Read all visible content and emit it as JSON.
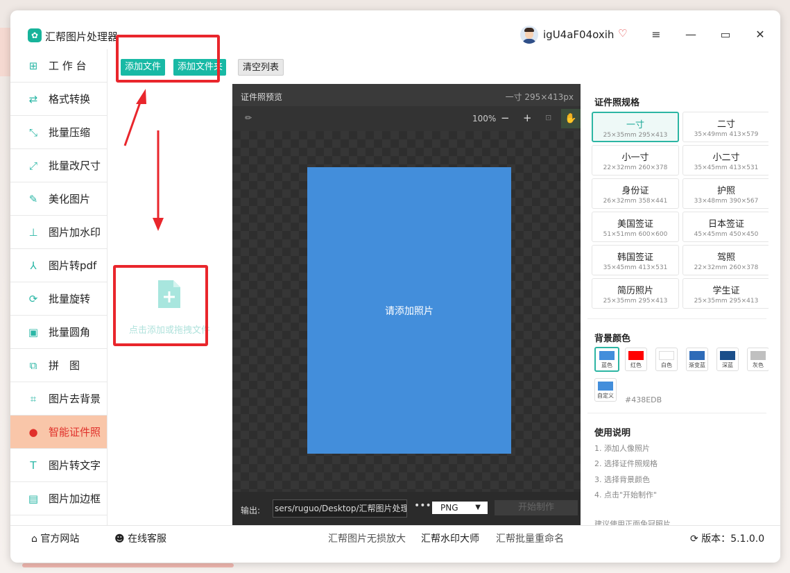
{
  "app": {
    "title": "汇帮图片处理器",
    "username": "igU4aF04oxih"
  },
  "window_controls": {
    "menu": "≡",
    "minimize": "—",
    "maximize": "▭",
    "close": "✕"
  },
  "sidebar": {
    "items": [
      {
        "label": "工 作 台",
        "icon": "grid-icon",
        "glyph": "⊞"
      },
      {
        "label": "格式转换",
        "icon": "convert-icon",
        "glyph": "⇄"
      },
      {
        "label": "批量压缩",
        "icon": "compress-icon",
        "glyph": "⤡"
      },
      {
        "label": "批量改尺寸",
        "icon": "resize-icon",
        "glyph": "⤢"
      },
      {
        "label": "美化图片",
        "icon": "beautify-icon",
        "glyph": "✎"
      },
      {
        "label": "图片加水印",
        "icon": "watermark-icon",
        "glyph": "⊥"
      },
      {
        "label": "图片转pdf",
        "icon": "pdf-icon",
        "glyph": "⅄"
      },
      {
        "label": "批量旋转",
        "icon": "rotate-icon",
        "glyph": "⟳"
      },
      {
        "label": "批量圆角",
        "icon": "round-corner-icon",
        "glyph": "▣"
      },
      {
        "label": "拼　图",
        "icon": "puzzle-icon",
        "glyph": "⧉"
      },
      {
        "label": "图片去背景",
        "icon": "crop-icon",
        "glyph": "⌗"
      },
      {
        "label": "智能证件照",
        "icon": "person-icon",
        "glyph": "●"
      },
      {
        "label": "图片转文字",
        "icon": "text-icon",
        "glyph": "T"
      },
      {
        "label": "图片加边框",
        "icon": "frame-icon",
        "glyph": "▤"
      }
    ]
  },
  "toolbar": {
    "add_file": "添加文件",
    "add_folder": "添加文件夹",
    "clear_list": "清空列表"
  },
  "dropzone": {
    "text": "点击添加或拖拽文件"
  },
  "preview": {
    "title": "证件照预览",
    "size_info": "一寸 295×413px",
    "zoom": "100%",
    "placeholder": "请添加照片"
  },
  "output": {
    "label": "输出:",
    "path": "sers/ruguo/Desktop/汇帮图片处理器",
    "dots": "•••",
    "format": "PNG",
    "start": "开始制作"
  },
  "specs": {
    "title": "证件照规格",
    "items": [
      {
        "name": "一寸",
        "size": "25×35mm 295×413",
        "selected": true
      },
      {
        "name": "二寸",
        "size": "35×49mm 413×579"
      },
      {
        "name": "小一寸",
        "size": "22×32mm 260×378"
      },
      {
        "name": "小二寸",
        "size": "35×45mm 413×531"
      },
      {
        "name": "身份证",
        "size": "26×32mm 358×441"
      },
      {
        "name": "护照",
        "size": "33×48mm 390×567"
      },
      {
        "name": "美国签证",
        "size": "51×51mm 600×600"
      },
      {
        "name": "日本签证",
        "size": "45×45mm 450×450"
      },
      {
        "name": "韩国签证",
        "size": "35×45mm 413×531"
      },
      {
        "name": "驾照",
        "size": "22×32mm 260×378"
      },
      {
        "name": "简历照片",
        "size": "25×35mm 295×413"
      },
      {
        "name": "学生证",
        "size": "25×35mm 295×413"
      }
    ]
  },
  "background": {
    "title": "背景颜色",
    "hex": "#438EDB",
    "swatches": [
      {
        "label": "蓝色",
        "color": "#438EDB",
        "selected": true
      },
      {
        "label": "红色",
        "color": "#FF0000"
      },
      {
        "label": "白色",
        "color": "#FFFFFF"
      },
      {
        "label": "渐变蓝",
        "color": "#2E6BB8"
      },
      {
        "label": "深蓝",
        "color": "#1A4E8A"
      },
      {
        "label": "灰色",
        "color": "#C0C0C0"
      },
      {
        "label": "自定义",
        "color": "#438EDB"
      }
    ]
  },
  "help": {
    "title": "使用说明",
    "steps": [
      "1. 添加人像照片",
      "2. 选择证件照规格",
      "3. 选择背景颜色",
      "4. 点击\"开始制作\""
    ],
    "tip": "建议使用正面免冠照片"
  },
  "footer": {
    "website": "官方网站",
    "support": "在线客服",
    "link1": "汇帮图片无损放大",
    "link2": "汇帮水印大师",
    "link3": "汇帮批量重命名",
    "version_label": "版本：",
    "version": "5.1.0.0"
  },
  "colors": {
    "accent": "#18b9a5",
    "active_bg": "#f9c6a9",
    "active_text": "#e0302a",
    "annotation": "#e9262c"
  }
}
